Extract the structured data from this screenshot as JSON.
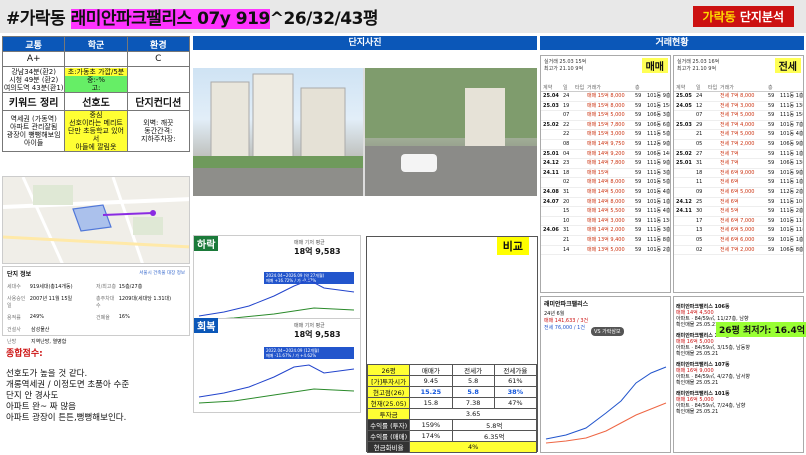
{
  "header": {
    "prefix": "#가락동 ",
    "highlight": "래미안파크팰리스 07y 919",
    "suffix": "^26/32/43평",
    "badge_yellow": "가락동",
    "badge_white": " 단지분석"
  },
  "left": {
    "headers": [
      "교통",
      "학군",
      "환경"
    ],
    "grades": [
      "A+",
      "",
      "C"
    ],
    "transport_text": [
      "강남34분(환2)",
      "시청 49분 (환2)",
      "여의도역 43분(환1)"
    ],
    "school_text": [
      "초:가동초 가깝/5분",
      "중:-%",
      "고:"
    ],
    "keywords": [
      "키워드 정리",
      "선호도",
      "단지컨디션"
    ],
    "keyword_notes_1": [
      "역세권 (가동역)",
      "아파트 관리잘됨",
      "광장이 뻥뻥해보임",
      "아이들"
    ],
    "keyword_notes_2": [
      "중심",
      "선호이라는 메리트",
      "단만 초등학교 있어서",
      "아들에 깔림옷"
    ],
    "keyword_notes_3": [
      "외벽: 깨끗",
      "동간간격:",
      "지하주차장:"
    ],
    "info_title": "단지 정보",
    "info_link": "서울시 건축물 대장 정보",
    "info_rows": [
      [
        "세대수",
        "919세대(총14개동)",
        "저/최고층",
        "15층/27층"
      ],
      [
        "사용승인일",
        "2007년 11월 15일",
        "총주차대수",
        "1209대(세대당 1.31대)"
      ],
      [
        "용적률",
        "249%",
        "건폐율",
        "16%"
      ],
      [
        "건설사",
        "삼성물산",
        "",
        ""
      ],
      [
        "난방",
        "지역난방, 열병합",
        "",
        ""
      ]
    ],
    "summary_title": "종합점수:",
    "summary_lines": [
      "선호도가 높을 것 같다.",
      "개롱역세권 / 이정도면 초품아 수준",
      "단지 안 경사도",
      "아파트 완~ 짜 많음",
      "아파트 광장이 튼튼,뻥뻥해보인다."
    ]
  },
  "center": {
    "photos_title": "단지사진",
    "chart1": {
      "tag": "하락",
      "header": "매매 기저 평균",
      "price": "18억 9,583",
      "period": "2024.04~2026.09 (약 27개월)",
      "change": "매매 +16.72% / 가 -0.47%"
    },
    "chart2": {
      "tag": "회복",
      "header": "매매 기저 평균",
      "price": "18억 9,583",
      "period": "2022.04~2024.09 (12개월)",
      "change": "매매 -11.67% / 가 +4.62%"
    },
    "compare_label": "비교",
    "compare_table": {
      "header": [
        "26평",
        "매매가",
        "전세가",
        "전세가율"
      ],
      "rows": [
        [
          "[가]투자시가",
          "9.45",
          "5.8",
          "61%"
        ],
        [
          "현고점(26)",
          "15.25",
          "5.8",
          "38%"
        ],
        [
          "현재(25.05)",
          "15.8",
          "7.38",
          "47%"
        ],
        [
          "투자금",
          "3.65",
          "",
          ""
        ],
        [
          "수익률 (투자)",
          "159%",
          "5.8억",
          ""
        ],
        [
          "수익률 (매매)",
          "174%",
          "6.35억",
          ""
        ],
        [
          "현금화비율",
          "4%",
          "",
          ""
        ]
      ]
    }
  },
  "right": {
    "title": "거래현황",
    "sale": {
      "label": "매매",
      "head_line1": "실거래 25.03 15억",
      "head_line2": "최고가 21.10 9억",
      "columns": [
        "계약",
        "일",
        "타입",
        "거래가",
        "층"
      ],
      "rows": [
        [
          "25.04",
          "24",
          "",
          "매매 15억 8,000",
          "59",
          "101동 9층"
        ],
        [
          "25.03",
          "19",
          "",
          "매매 15억 8,000",
          "59",
          "101동 15층"
        ],
        [
          "",
          "07",
          "",
          "매매 15억 5,000",
          "59",
          "106동 3층"
        ],
        [
          "25.02",
          "22",
          "",
          "매매 15억 7,800",
          "59",
          "106동 6층"
        ],
        [
          "",
          "22",
          "",
          "매매 15억 3,000",
          "59",
          "111동 5층"
        ],
        [
          "",
          "08",
          "",
          "매매 14억 9,750",
          "59",
          "112동 9층"
        ],
        [
          "25.01",
          "04",
          "",
          "매매 14억 9,200",
          "59",
          "106동 14층"
        ],
        [
          "24.12",
          "23",
          "",
          "매매 14억 7,800",
          "59",
          "111동 9층"
        ],
        [
          "24.11",
          "18",
          "",
          "매매 15억",
          "59",
          "111동 3층"
        ],
        [
          "",
          "02",
          "",
          "매매 14억 8,000",
          "59",
          "101동 5층"
        ],
        [
          "24.08",
          "31",
          "",
          "매매 14억 5,000",
          "59",
          "101동 4층"
        ],
        [
          "24.07",
          "20",
          "",
          "매매 14억 8,000",
          "59",
          "101동 1층"
        ],
        [
          "",
          "15",
          "",
          "매매 14억 5,500",
          "59",
          "111동 4층"
        ],
        [
          "",
          "10",
          "",
          "매매 14억 3,000",
          "59",
          "111동 13층"
        ],
        [
          "24.06",
          "31",
          "",
          "매매 14억 2,000",
          "59",
          "111동 3층"
        ],
        [
          "",
          "21",
          "",
          "매매 13억 9,400",
          "59",
          "111동 8층"
        ],
        [
          "",
          "14",
          "",
          "매매 13억 5,000",
          "59",
          "101동 2층"
        ]
      ]
    },
    "lease": {
      "label": "전세",
      "head_line1": "실거래 25.03 16억",
      "head_line2": "최고가 21.10 9억",
      "columns": [
        "계약",
        "일",
        "타입",
        "거래가",
        "층"
      ],
      "rows": [
        [
          "25.05",
          "24",
          "",
          "전세 7억 8,000",
          "59",
          "111동 1층"
        ],
        [
          "24.05",
          "12",
          "",
          "전세 7억 3,000",
          "59",
          "111동 13층"
        ],
        [
          "",
          "07",
          "",
          "전세 7억 5,000",
          "59",
          "111동 15층"
        ],
        [
          "25.03",
          "29",
          "",
          "전세 7억 4,000",
          "59",
          "101동 7층"
        ],
        [
          "",
          "21",
          "",
          "전세 7억 5,000",
          "59",
          "101동 4층"
        ],
        [
          "",
          "05",
          "",
          "전세 7억 2,000",
          "59",
          "106동 9층"
        ],
        [
          "25.02",
          "27",
          "",
          "전세 7억",
          "59",
          "111동 1층"
        ],
        [
          "25.01",
          "31",
          "",
          "전세 7억",
          "59",
          "106동 13층"
        ],
        [
          "",
          "18",
          "",
          "전세 6억 9,000",
          "59",
          "101동 9층"
        ],
        [
          "",
          "11",
          "",
          "전세 6억",
          "59",
          "111동 1층"
        ],
        [
          "",
          "09",
          "",
          "전세 6억 5,000",
          "59",
          "112동 2층"
        ],
        [
          "24.12",
          "25",
          "",
          "전세 6억",
          "59",
          "111동 10층"
        ],
        [
          "24.11",
          "30",
          "",
          "전세 5억",
          "59",
          "111동 2층"
        ],
        [
          "",
          "17",
          "",
          "전세 6억 7,000",
          "59",
          "101동 11층"
        ],
        [
          "",
          "13",
          "",
          "전세 6억 5,000",
          "59",
          "101동 11층"
        ],
        [
          "",
          "05",
          "",
          "전세 6억 6,000",
          "59",
          "101동 1층"
        ],
        [
          "",
          "02",
          "",
          "전세 7억 2,000",
          "59",
          "106동 8층"
        ]
      ]
    },
    "chart3": {
      "title": "래미안파크팰리스",
      "period": "24년 6월",
      "sale_avg": "매매 141,633 / 3건",
      "lease_avg": "전세 76,000 / 1건",
      "legend": "VS 가락삼보"
    },
    "min_badge": "26평 최저가: 16.4억",
    "listings": [
      {
        "name": "래미안파크팰리스 106동",
        "price": "매매 14억 4,500",
        "desc": "아파트 · 84/59㎡, 11/27층, 남향",
        "note": "확인매물 25.05.21"
      },
      {
        "name": "래미안파크팰리스 106동",
        "price": "매매 16억 5,000",
        "desc": "아파트 · 84/59㎡, 3/15층, 남동향",
        "note": "확인매물 25.05.21"
      },
      {
        "name": "래미안파크팰리스 107동",
        "price": "매매 16억 9,000",
        "desc": "아파트 · 84/59㎡, 4/27층, 남서향",
        "note": "확인매물 25.05.21"
      },
      {
        "name": "래미안파크팰리스 101동",
        "price": "매매 16억 5,000",
        "desc": "아파트 · 84/59㎡, 7/24층, 남향",
        "note": "확인매물 25.05.21"
      }
    ]
  },
  "colors": {
    "accent_blue": "#0b57b8",
    "highlight_pink": "#ff33ff",
    "badge_red": "#cc1111",
    "yellow": "#ffff33",
    "green": "#66ee66"
  }
}
